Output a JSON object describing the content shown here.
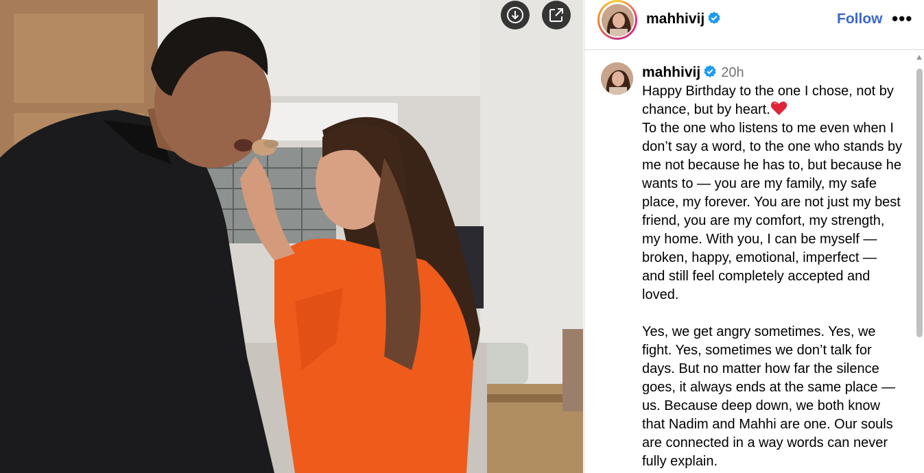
{
  "post": {
    "username": "mahhivij",
    "verified": true,
    "follow_label": "Follow",
    "more_label": "•••",
    "time_ago": "20h"
  },
  "caption": {
    "username": "mahhivij",
    "line1": "Happy Birthday to the one I chose, not by chance, but by heart.",
    "body1": "To the one who listens to me even when I don’t say a word, to the one who stands by me not because he has to, but because he wants to — you are my family, my safe place, my forever. You are not just my best friend, you are my comfort, my strength, my home. With you, I can be myself — broken, happy, emotional, imperfect — and still feel completely accepted and loved.",
    "body2": "Yes, we get angry sometimes. Yes, we fight. Yes, sometimes we don’t talk for days. But no matter how far the silence goes, it always ends at the same place — us. Because deep down, we both know that Nadim and Mahhi are one. Our souls are connected in a way words can never fully explain."
  },
  "icons": {
    "download": "download-icon",
    "share": "external-link-icon",
    "verified": "verified-badge-icon",
    "heart": "red-heart-emoji"
  },
  "colors": {
    "follow": "#3b67c8",
    "verified": "#1d9bf0",
    "time": "#737373",
    "heart": "#e0243a"
  }
}
